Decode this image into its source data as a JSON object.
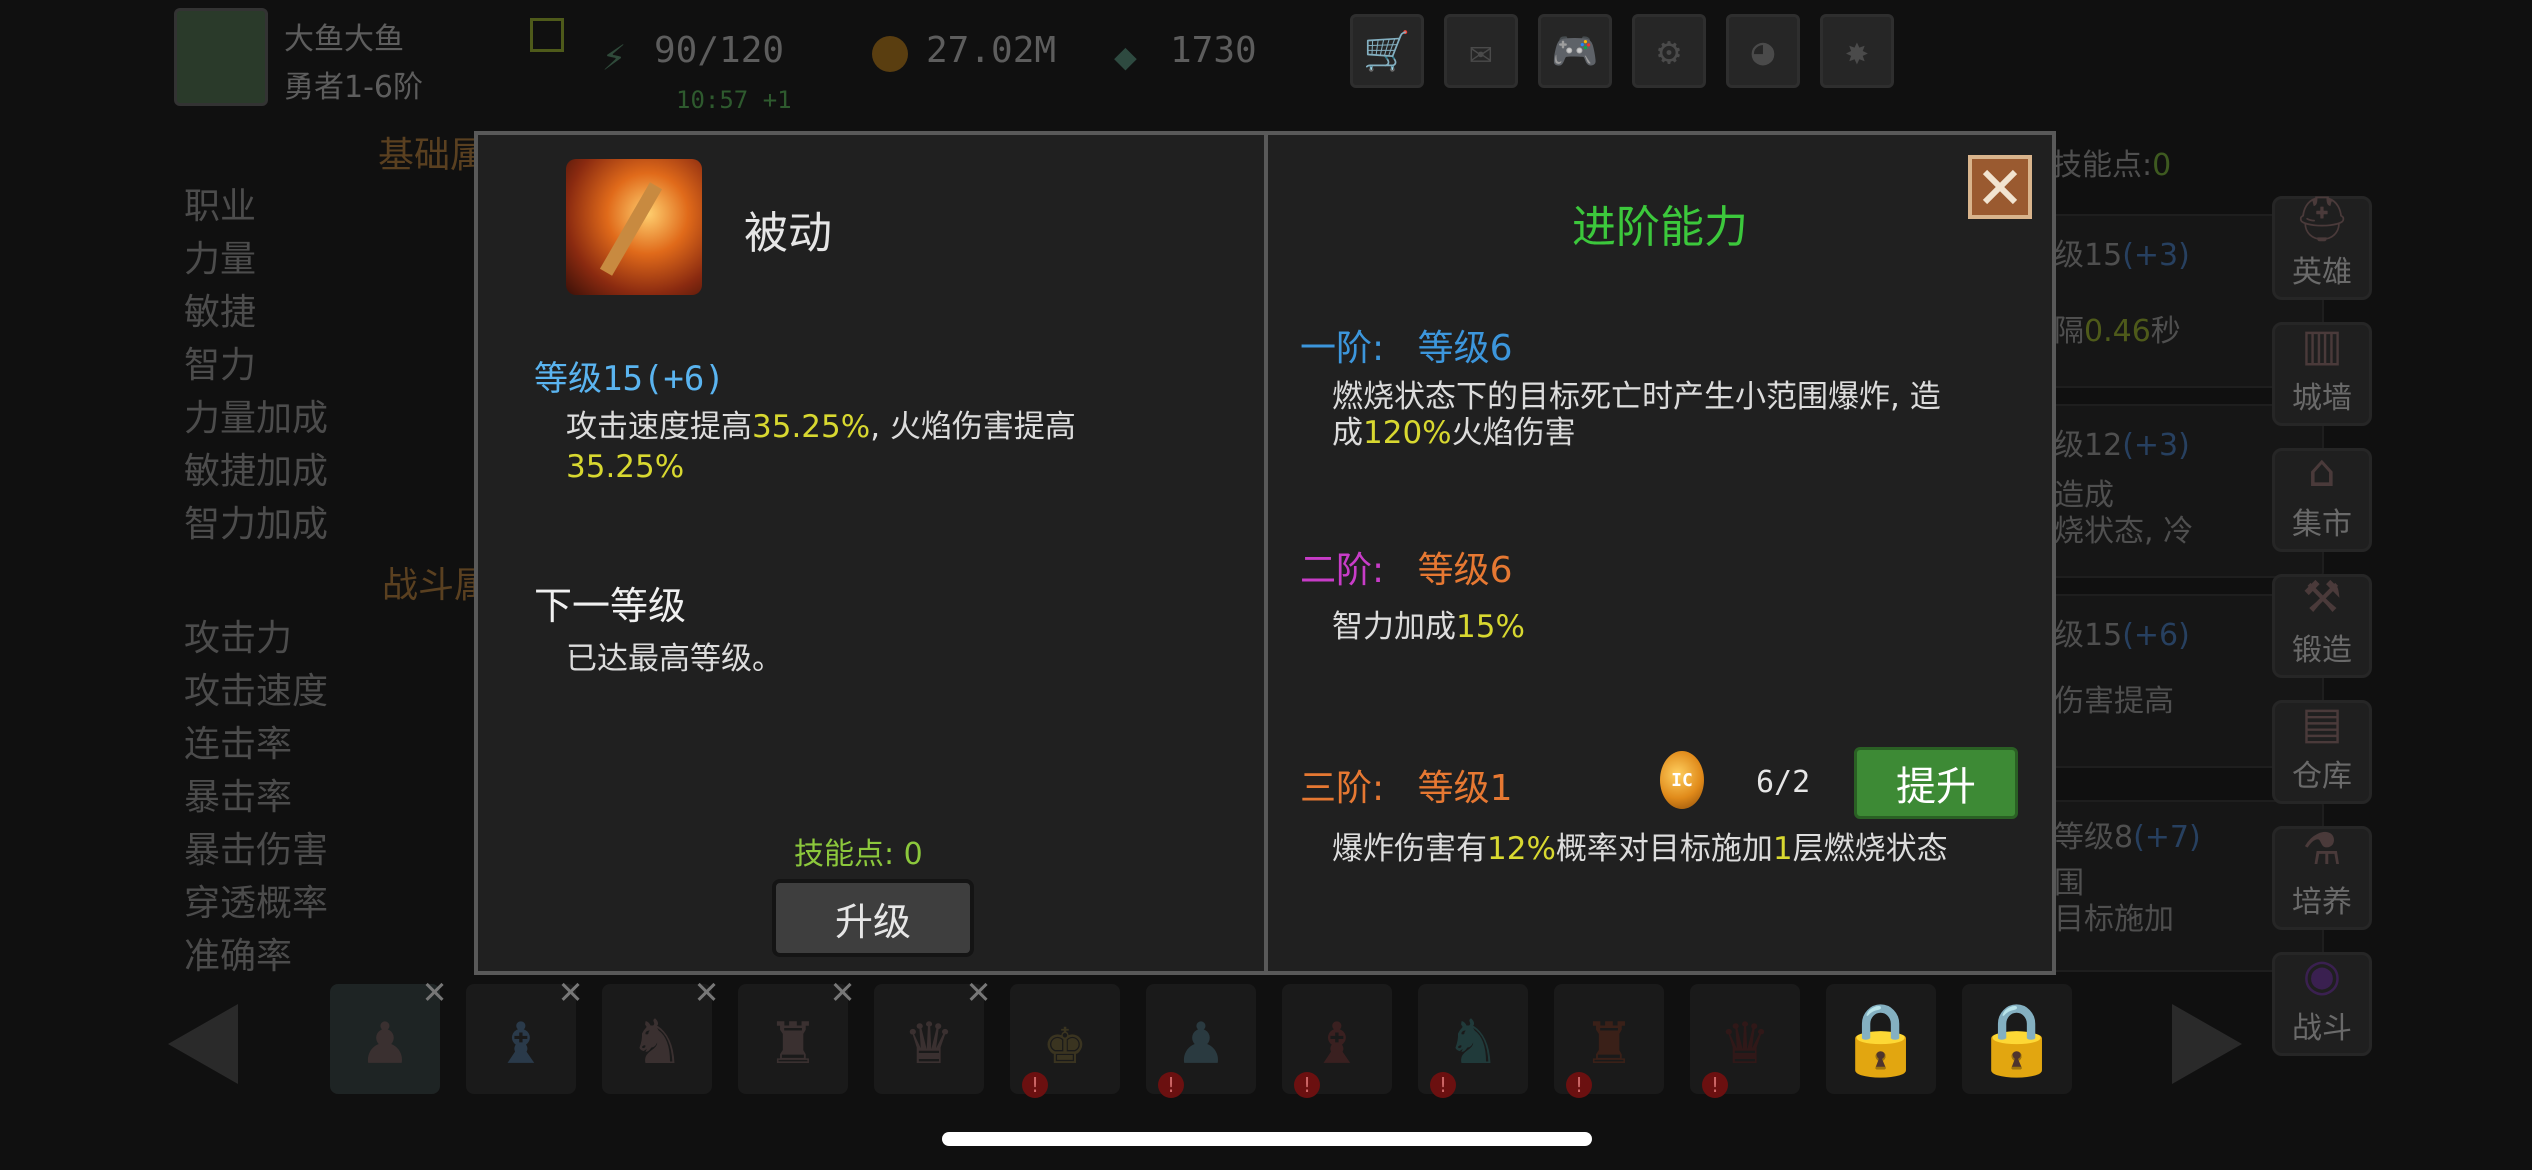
{
  "player": {
    "name": "大鱼大鱼",
    "rank": "勇者1-6阶"
  },
  "resources": {
    "energy": "90/120",
    "energy_timer": "10:57 +1",
    "gold": "27.02M",
    "gems": "1730"
  },
  "background": {
    "section_basic": "基础属",
    "section_battle": "战斗属",
    "skill_points_label": "技能点:",
    "skill_points_value": "0",
    "basic_stats": [
      "职业",
      "力量",
      "敏捷",
      "智力",
      "力量加成",
      "敏捷加成",
      "智力加成"
    ],
    "battle_stats": [
      "攻击力",
      "攻击速度",
      "连击率",
      "暴击率",
      "暴击伤害",
      "穿透概率",
      "准确率"
    ],
    "cards": [
      {
        "line1": "级15",
        "bonus": "(+3)",
        "line2": "隔",
        "value2": "0.46",
        "suffix2": "秒"
      },
      {
        "line1": "级12",
        "bonus": "(+3)",
        "line2": "造成",
        "line3": "烧状态, 冷"
      },
      {
        "line1": "级15",
        "bonus": "(+6)",
        "line2": "伤害提高"
      },
      {
        "line1": "等级8",
        "bonus": "(+7)",
        "line2": "围",
        "line3": "目标施加"
      }
    ],
    "side_menu": [
      "英雄",
      "城墙",
      "集市",
      "锻造",
      "仓库",
      "培养",
      "战斗"
    ]
  },
  "modal": {
    "skill_type": "被动",
    "level_text": "等级15(+6)",
    "desc_part1": "攻击速度提高",
    "desc_val1": "35.25%",
    "desc_part2": ", 火焰伤害提高",
    "desc_val2": "35.25%",
    "next_level_title": "下一等级",
    "next_level_text": "已达最高等级。",
    "skill_points_label": "技能点: ",
    "skill_points_value": "0",
    "upgrade_button": "升级",
    "advanced_title": "进阶能力",
    "tier1": {
      "label": "一阶:",
      "level": "等级6",
      "desc_a": "燃烧状态下的目标死亡时产生小范围爆炸, 造",
      "desc_b1": "成",
      "desc_val": "120%",
      "desc_b2": "火焰伤害"
    },
    "tier2": {
      "label": "二阶:",
      "level": "等级6",
      "desc_a": "智力加成",
      "desc_val": "15%"
    },
    "tier3": {
      "label": "三阶:",
      "level": "等级1",
      "cost": "6/2",
      "button": "提升",
      "desc_a": "爆炸伤害有",
      "desc_val1": "12%",
      "desc_b": "概率对目标施加",
      "desc_val2": "1",
      "desc_c": "层燃烧状态"
    }
  },
  "colors": {
    "skill_blue": "#5ab4f0",
    "advanced_green": "#3cc83c",
    "tier1": "#3c96dc",
    "tier2": "#c83cc8",
    "tier3": "#e67832",
    "highlight": "#d8d830",
    "points_green": "#8cc83c"
  }
}
